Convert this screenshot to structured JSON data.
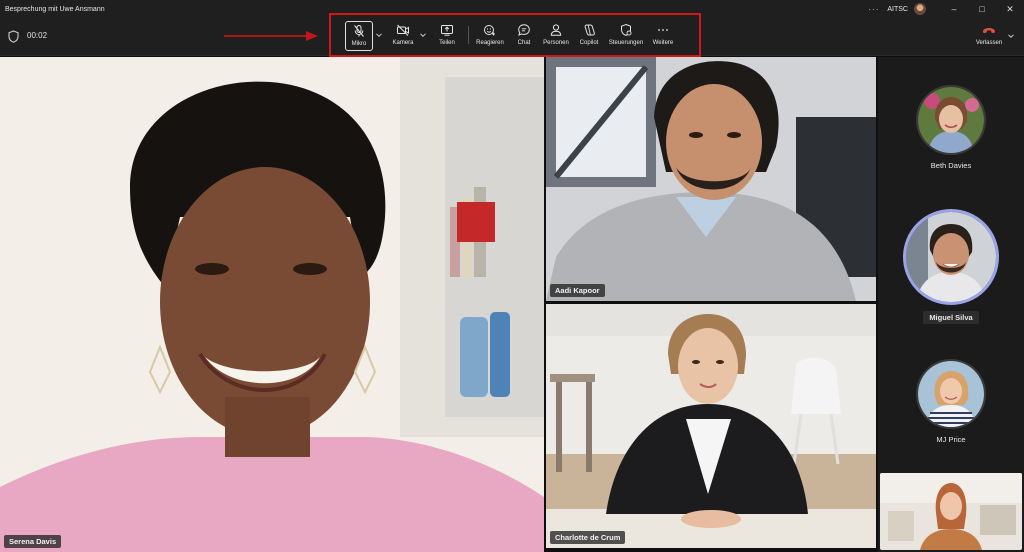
{
  "window": {
    "title": "Besprechung mit Uwe Ansmann",
    "org": "AITSC",
    "more": "···"
  },
  "toolbar": {
    "timer": "00:02",
    "buttons": {
      "mic": "Mikro",
      "camera": "Kamera",
      "share": "Teilen",
      "react": "Reagieren",
      "chat": "Chat",
      "people": "Personen",
      "copilot": "Copilot",
      "controls": "Steuerungen",
      "more": "Weitere"
    },
    "leave": "Verlassen"
  },
  "stage": {
    "tiles": [
      {
        "name": "Serena Davis"
      },
      {
        "name": "Aadi Kapoor"
      },
      {
        "name": "Charlotte de Crum"
      }
    ]
  },
  "sidebar": {
    "participants": [
      {
        "name": "Beth Davies"
      },
      {
        "name": "Miguel Silva"
      },
      {
        "name": "MJ Price"
      }
    ]
  },
  "colors": {
    "highlight": "#d01818",
    "leave": "#d9533d",
    "speaking_ring": "#9aa3e8"
  }
}
